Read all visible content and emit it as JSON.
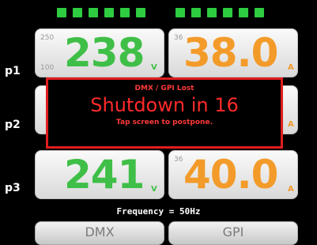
{
  "indicators": {
    "group1": [
      1,
      1,
      1,
      1,
      1,
      1
    ],
    "group2": [
      1,
      1,
      1,
      1,
      1,
      1
    ],
    "color": "#2ecc40"
  },
  "rows": [
    {
      "label": "p1",
      "volt": {
        "value": "238",
        "unit": "V",
        "max": "250",
        "min": "100"
      },
      "amp": {
        "value": "38.0",
        "unit": "A",
        "max": "36"
      }
    },
    {
      "label": "p2",
      "volt": {
        "value": "",
        "unit": "",
        "max": "",
        "min": ""
      },
      "amp": {
        "value": "",
        "unit": "A",
        "max": ""
      }
    },
    {
      "label": "p3",
      "volt": {
        "value": "241",
        "unit": "V",
        "max": "",
        "min": ""
      },
      "amp": {
        "value": "40.0",
        "unit": "A",
        "max": "36"
      }
    }
  ],
  "alert": {
    "title": "DMX / GPI Lost",
    "message": "Shutdown in 16",
    "hint": "Tap screen to postpone."
  },
  "frequency_text": "Frequency = 50Hz",
  "buttons": {
    "dmx": "DMX",
    "gpi": "GPI"
  },
  "colors": {
    "volt": "#3fbf47",
    "amp": "#f39b2a",
    "alert": "#e01e1e"
  }
}
